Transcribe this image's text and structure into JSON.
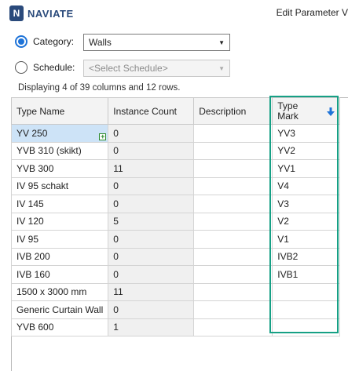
{
  "header": {
    "logo_text": "NAVIATE",
    "logo_letter": "N",
    "title": "Edit Parameter V"
  },
  "category": {
    "label": "Category:",
    "value": "Walls",
    "checked": true
  },
  "schedule": {
    "label": "Schedule:",
    "placeholder": "<Select Schedule>",
    "checked": false
  },
  "info_text": "Displaying 4 of 39 columns and 12 rows.",
  "table": {
    "headers": {
      "type_name": "Type Name",
      "instance_count": "Instance Count",
      "description": "Description",
      "type_mark": "Type\nMark"
    },
    "rows": [
      {
        "type_name": "YV 250",
        "instance_count": "0",
        "description": "",
        "type_mark": "YV3"
      },
      {
        "type_name": "YVB 310 (skikt)",
        "instance_count": "0",
        "description": "",
        "type_mark": "YV2"
      },
      {
        "type_name": "YVB 300",
        "instance_count": "11",
        "description": "",
        "type_mark": "YV1"
      },
      {
        "type_name": "IV 95 schakt",
        "instance_count": "0",
        "description": "",
        "type_mark": "V4"
      },
      {
        "type_name": "IV 145",
        "instance_count": "0",
        "description": "",
        "type_mark": "V3"
      },
      {
        "type_name": "IV 120",
        "instance_count": "5",
        "description": "",
        "type_mark": "V2"
      },
      {
        "type_name": "IV 95",
        "instance_count": "0",
        "description": "",
        "type_mark": "V1"
      },
      {
        "type_name": "IVB 200",
        "instance_count": "0",
        "description": "",
        "type_mark": "IVB2"
      },
      {
        "type_name": "IVB 160",
        "instance_count": "0",
        "description": "",
        "type_mark": "IVB1"
      },
      {
        "type_name": "1500 x 3000 mm",
        "instance_count": "11",
        "description": "",
        "type_mark": ""
      },
      {
        "type_name": "Generic Curtain Wall",
        "instance_count": "0",
        "description": "",
        "type_mark": ""
      },
      {
        "type_name": "YVB 600",
        "instance_count": "1",
        "description": "",
        "type_mark": ""
      }
    ]
  },
  "colors": {
    "accent": "#1e73d8",
    "highlight": "#16a085",
    "logo": "#2a4a7b"
  }
}
